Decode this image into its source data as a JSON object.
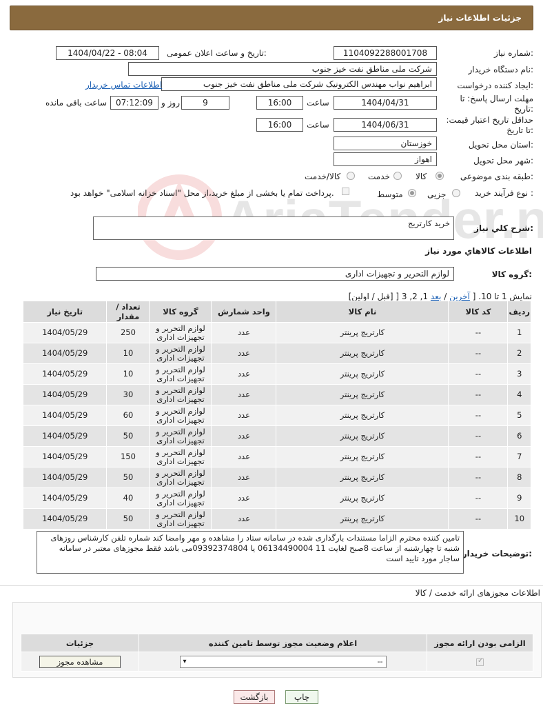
{
  "header": {
    "title": "جزئیات اطلاعات نیاز"
  },
  "form": {
    "need_number_label": "شماره نیاز:",
    "need_number": "1104092288001708",
    "announce_label": "تاریخ و ساعت اعلان عمومی:",
    "announce_value": "1404/04/22 - 08:04",
    "buyer_label": "نام دستگاه خریدار:",
    "buyer_value": "شرکت ملی مناطق نفت خیز جنوب",
    "creator_label": "ایجاد کننده درخواست:",
    "creator_value": "ابراهیم نواب مهندس الکترونیک شرکت ملی مناطق نفت خیز جنوب",
    "contact_link": "اطلاعات تماس خریدار",
    "deadline_label": "مهلت ارسال پاسخ: تا تاریخ:",
    "deadline_date": "1404/04/31",
    "time_label": "ساعت",
    "deadline_time": "16:00",
    "days_value": "9",
    "days_label": "روز و",
    "remaining_time": "07:12:09",
    "remaining_label": "ساعت باقی مانده",
    "validity_label": "حداقل تاریخ اعتبار قیمت: تا تاریخ:",
    "validity_date": "1404/06/31",
    "validity_time": "16:00",
    "province_label": "استان محل تحویل:",
    "province_value": "خوزستان",
    "city_label": "شهر محل تحویل:",
    "city_value": "اهواز",
    "category_label": "طبقه بندی موضوعی:",
    "category_options": [
      "کالا",
      "خدمت",
      "کالا/خدمت"
    ],
    "process_label": "نوع فرآیند خرید :",
    "process_options": [
      "جزیی",
      "متوسط"
    ],
    "payment_note": "پرداخت تمام یا بخشی از مبلغ خرید،از محل \"اسناد خزانه اسلامی\" خواهد بود."
  },
  "summary": {
    "label": "شرح کلي نياز:",
    "value": "خرید کارتریج",
    "goods_info_title": "اطلاعات کالاهاي مورد نياز",
    "group_label": "گروه کالا:",
    "group_value": "لوازم التحریر و تجهیزات اداری"
  },
  "pagination": {
    "prefix": "نمایش 1 تا 10. [",
    "last": "آخرین",
    "sep": "/",
    "next": "بعد",
    "pages": "] 3 ,2 ,1",
    "rest": "[قبل / اولین]"
  },
  "table": {
    "headers": [
      "ردیف",
      "کد کالا",
      "نام کالا",
      "واحد شمارش",
      "گروه کالا",
      "تعداد / مقدار",
      "تاریخ نیاز"
    ],
    "rows": [
      [
        "1",
        "--",
        "کارتریج پرینتر",
        "عدد",
        "لوازم التحریر و تجهیزات اداری",
        "250",
        "1404/05/29"
      ],
      [
        "2",
        "--",
        "کارتریج پرینتر",
        "عدد",
        "لوازم التحریر و تجهیزات اداری",
        "10",
        "1404/05/29"
      ],
      [
        "3",
        "--",
        "کارتریج پرینتر",
        "عدد",
        "لوازم التحریر و تجهیزات اداری",
        "10",
        "1404/05/29"
      ],
      [
        "4",
        "--",
        "کارتریج پرینتر",
        "عدد",
        "لوازم التحریر و تجهیزات اداری",
        "30",
        "1404/05/29"
      ],
      [
        "5",
        "--",
        "کارتریج پرینتر",
        "عدد",
        "لوازم التحریر و تجهیزات اداری",
        "60",
        "1404/05/29"
      ],
      [
        "6",
        "--",
        "کارتریج پرینتر",
        "عدد",
        "لوازم التحریر و تجهیزات اداری",
        "50",
        "1404/05/29"
      ],
      [
        "7",
        "--",
        "کارتریج پرینتر",
        "عدد",
        "لوازم التحریر و تجهیزات اداری",
        "150",
        "1404/05/29"
      ],
      [
        "8",
        "--",
        "کارتریج پرینتر",
        "عدد",
        "لوازم التحریر و تجهیزات اداری",
        "50",
        "1404/05/29"
      ],
      [
        "9",
        "--",
        "کارتریج پرینتر",
        "عدد",
        "لوازم التحریر و تجهیزات اداری",
        "40",
        "1404/05/29"
      ],
      [
        "10",
        "--",
        "کارتریج پرینتر",
        "عدد",
        "لوازم التحریر و تجهیزات اداری",
        "50",
        "1404/05/29"
      ]
    ]
  },
  "buyer_notes": {
    "label": "توضیحات خریدار:",
    "text": "تامین کننده محترم الزاما مستندات بارگذاری شده در سامانه ستاد را مشاهده و مهر وامضا کند شماره تلفن کارشناس روزهای شنبه تا چهارشنبه از ساعت 8صبح  لغایت  11    06134490004   یا 09392374804می باشد فقط مجوزهای معتبر در سامانه ساجار مورد تایید است"
  },
  "licenses": {
    "title": "اطلاعات مجوزهای ارائه خدمت / کالا",
    "headers": [
      "الزامی بودن ارائه مجوز",
      "اعلام وضعیت مجوز توسط تامین کننده",
      "جزئیات"
    ],
    "select_value": "--",
    "view_button": "مشاهده مجوز"
  },
  "actions": {
    "print": "چاپ",
    "back": "بازگشت"
  },
  "watermark_text": "AriaTender.neT"
}
